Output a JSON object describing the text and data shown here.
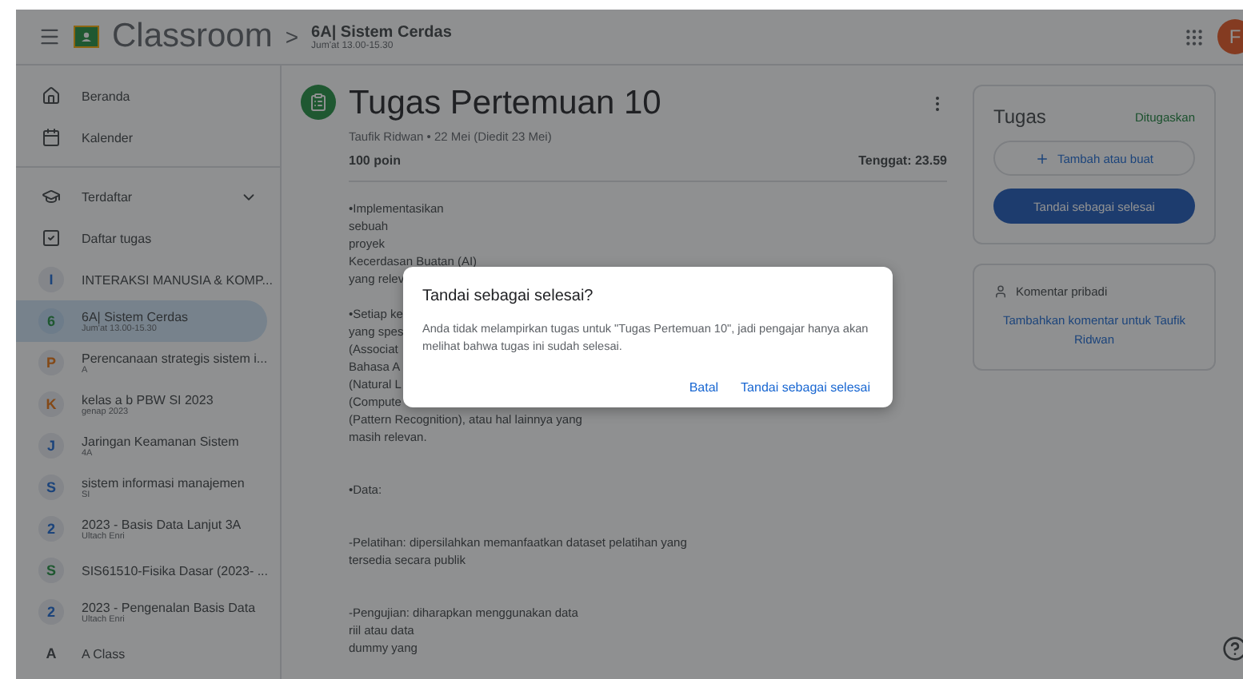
{
  "app_bar": {
    "app_name": "Classroom",
    "separator": ">",
    "class_title": "6A| Sistem Cerdas",
    "class_subtitle": "Jum'at 13.00-15.30",
    "avatar": "F"
  },
  "sidebar": {
    "nav": [
      {
        "label": "Beranda",
        "kind": "home"
      },
      {
        "label": "Kalender",
        "kind": "calendar"
      }
    ],
    "enrolled": {
      "label": "Terdaftar",
      "expanded": true
    },
    "todo": {
      "label": "Daftar tugas"
    },
    "classes": [
      {
        "letter": "I",
        "title": "INTERAKSI MANUSIA & KOMP...",
        "color": "#1c447b",
        "selected": false
      },
      {
        "letter": "6",
        "title": "6A| Sistem Cerdas",
        "subtitle": "Jum'at 13.00-15.30",
        "color": "#1f5831",
        "selected": true
      },
      {
        "letter": "P",
        "title": "Perencanaan strategis sistem i...",
        "subtitle": "A",
        "color": "#844917",
        "selected": false
      },
      {
        "letter": "K",
        "title": "kelas a b PBW SI 2023",
        "subtitle": "genap 2023",
        "color": "#844917",
        "selected": false
      },
      {
        "letter": "J",
        "title": "Jaringan Keamanan Sistem",
        "subtitle": "4A",
        "color": "#1c447b",
        "selected": false
      },
      {
        "letter": "S",
        "title": "sistem informasi manajemen",
        "subtitle": "SI",
        "color": "#1c447b",
        "selected": false
      },
      {
        "letter": "2",
        "title": "2023 - Basis Data Lanjut 3A",
        "subtitle": "Ultach Enri",
        "color": "#1c447b",
        "selected": false
      },
      {
        "letter": "S",
        "title": "SIS61510-Fisika Dasar (2023- ...",
        "color": "#1f5831",
        "selected": false
      },
      {
        "letter": "2",
        "title": "2023 - Pengenalan Basis Data",
        "subtitle": "Ultach Enri",
        "color": "#1c447b",
        "selected": false
      },
      {
        "letter": "A",
        "title": "A Class",
        "color": "#2e3134",
        "selected": false
      }
    ]
  },
  "assignment": {
    "title": "Tugas Pertemuan 10",
    "meta": "Taufik Ridwan • 22 Mei (Diedit 23 Mei)",
    "points": "100 poin",
    "due": "Tenggat: 23.59",
    "paragraphs": [
      {
        "lines": [
          "•Implementasikan",
          "sebuah",
          "proyek",
          "Kecerdasan Buatan (AI)",
          "yang relev"
        ]
      },
      {
        "lines": [
          "•Setiap ke",
          "yang spes",
          "(Associat",
          "Bahasa A",
          "(Natural L",
          "(Compute",
          "(Pattern Recognition), atau hal lainnya yang",
          "masih relevan."
        ]
      },
      {
        "lines": [
          "•Data:"
        ]
      },
      {
        "lines": [
          "-Pelatihan: dipersilahkan memanfaatkan dataset pelatihan yang",
          "tersedia secara publik"
        ]
      },
      {
        "lines": [
          "-Pengujian: diharapkan menggunakan data",
          "riil atau data",
          "dummy yang"
        ]
      }
    ]
  },
  "work_card": {
    "title": "Tugas",
    "status": "Ditugaskan",
    "add_button": "Tambah atau buat",
    "done_button": "Tandai sebagai selesai"
  },
  "comment_card": {
    "title": "Komentar pribadi",
    "link": "Tambahkan komentar untuk Taufik Ridwan"
  },
  "dialog": {
    "title": "Tandai sebagai selesai?",
    "body": "Anda tidak melampirkan tugas untuk \"Tugas Pertemuan 10\", jadi pengajar hanya akan melihat bahwa tugas ini sudah selesai.",
    "buttons": [
      "Batal",
      "Tandai sebagai selesai"
    ]
  }
}
